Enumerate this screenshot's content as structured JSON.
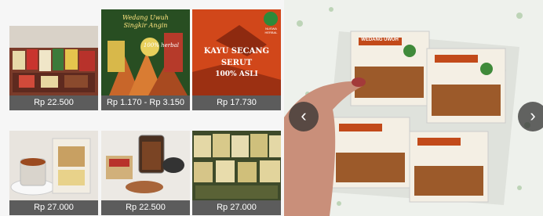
{
  "products": [
    {
      "price": "Rp 22.500"
    },
    {
      "price": "Rp 1.170 - Rp 3.150",
      "banner_line1": "Wedang Uwuh",
      "banner_line2": "Singkir Angin",
      "banner_badge": "100% herbal"
    },
    {
      "price": "Rp 17.730",
      "banner_title": "KAYU SECANG",
      "banner_sub": "SERUT",
      "banner_claim": "100% ASLI",
      "badge": "NUSWA HERBAL"
    },
    {
      "price": "Rp 27.000"
    },
    {
      "price": "Rp 22.500"
    },
    {
      "price": "Rp 27.000"
    }
  ],
  "promo": {
    "package_label": "WEDANG UWUH",
    "prev_symbol": "‹",
    "next_symbol": "›"
  },
  "colors": {
    "price_bar": "#5c5c5c",
    "nav": "#333333"
  }
}
